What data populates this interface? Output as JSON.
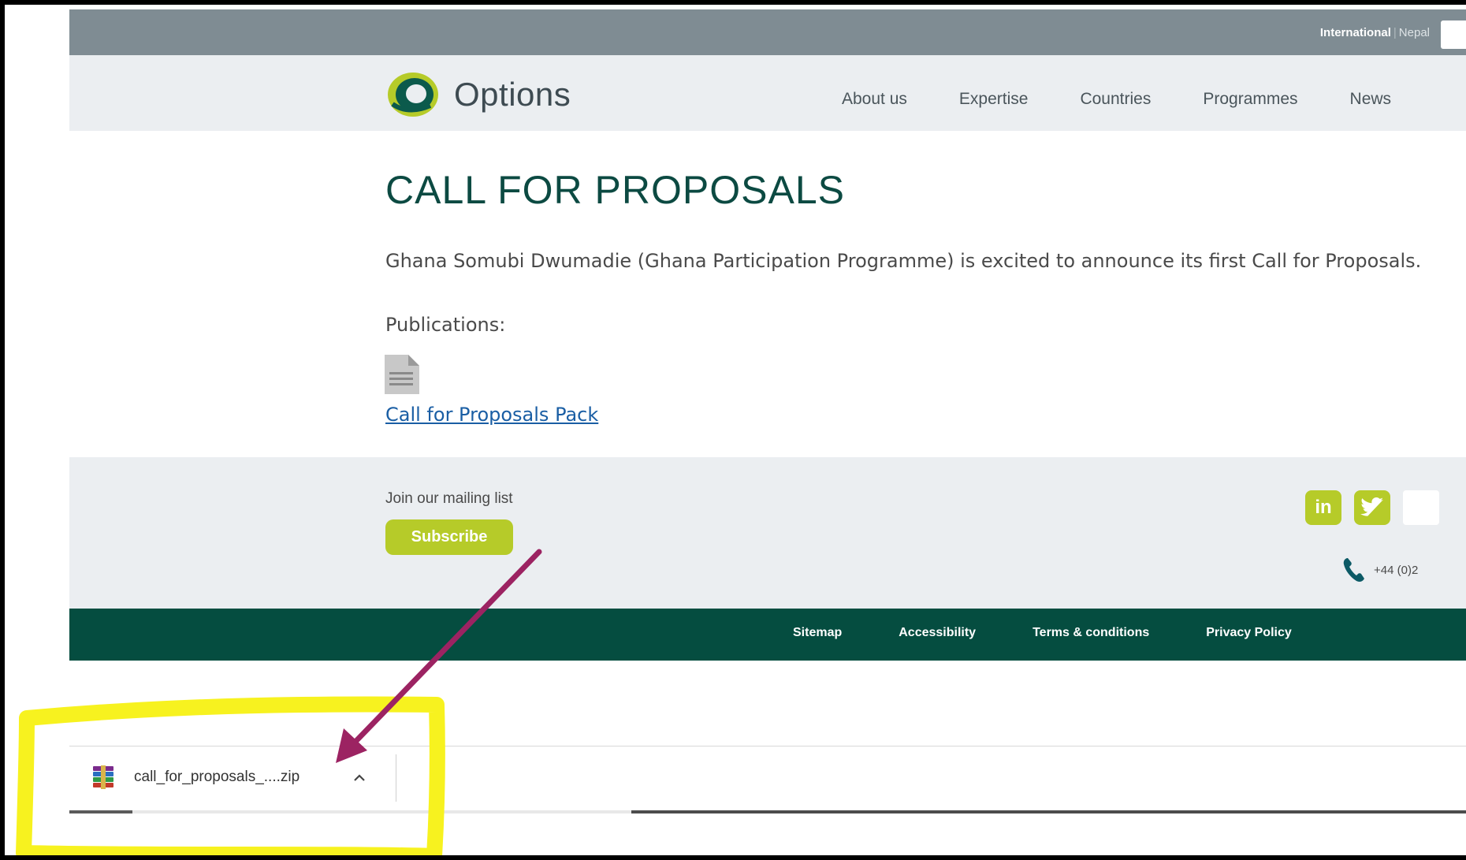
{
  "topbar": {
    "region_active": "International",
    "region_separator": "|",
    "region_other": "Nepal"
  },
  "header": {
    "logo_text": "Options",
    "nav": [
      "About us",
      "Expertise",
      "Countries",
      "Programmes",
      "News"
    ]
  },
  "main": {
    "title": "CALL FOR PROPOSALS",
    "intro": "Ghana Somubi Dwumadie (Ghana Participation Programme) is excited to announce its first Call for Proposals.",
    "publications_label": "Publications:",
    "publication_link": "Call for Proposals Pack"
  },
  "footer": {
    "mailing_label": "Join our mailing list",
    "subscribe_label": "Subscribe",
    "linkedin_glyph": "in",
    "phone": "+44 (0)2"
  },
  "footer_links": [
    "Sitemap",
    "Accessibility",
    "Terms & conditions",
    "Privacy Policy"
  ],
  "download": {
    "filename": "call_for_proposals_....zip"
  },
  "colors": {
    "brand_green": "#b6cb29",
    "dark_green": "#054d40",
    "title_green": "#0c4a42",
    "topbar_grey": "#7f8c93",
    "annotation_yellow": "#f7f21f",
    "annotation_arrow": "#9c2362"
  },
  "icons": [
    "options-logo-icon",
    "document-icon",
    "linkedin-icon",
    "twitter-icon",
    "phone-icon",
    "zip-file-icon",
    "chevron-up-icon"
  ]
}
